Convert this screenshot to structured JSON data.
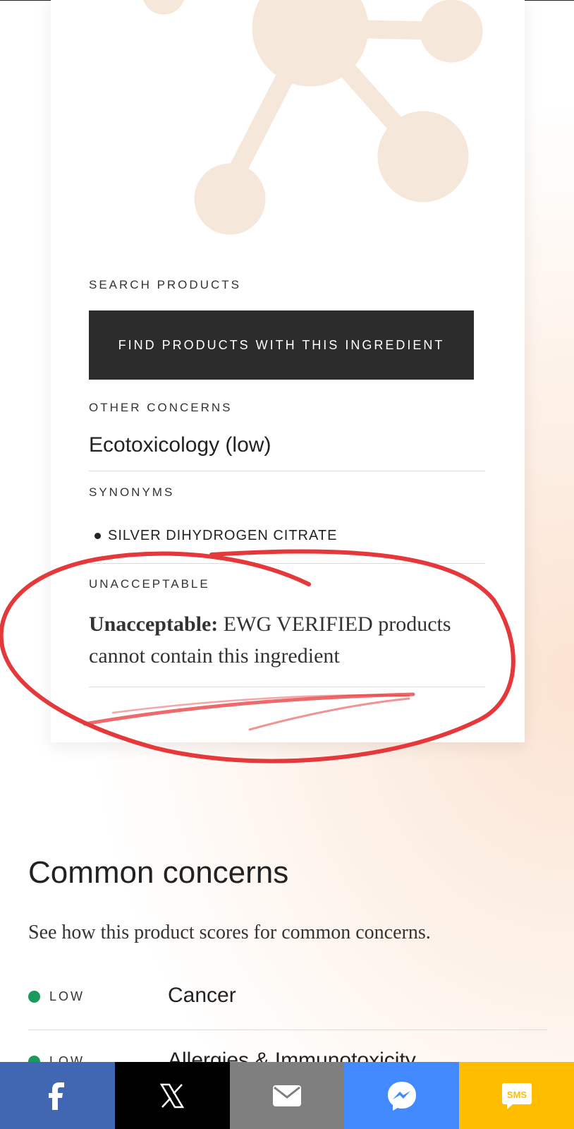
{
  "card": {
    "search_label": "SEARCH PRODUCTS",
    "find_button": "FIND PRODUCTS WITH THIS INGREDIENT",
    "other_concerns_label": "OTHER CONCERNS",
    "other_concerns_value": "Ecotoxicology (low)",
    "synonyms_label": "SYNONYMS",
    "synonyms": [
      "SILVER DIHYDROGEN CITRATE"
    ],
    "unacceptable_label": "UNACCEPTABLE",
    "unacceptable_bold": "Unacceptable:",
    "unacceptable_text": " EWG VERIFIED products cannot contain this ingredient"
  },
  "common_concerns": {
    "title": "Common concerns",
    "subtitle": "See how this product scores for common concerns.",
    "rows": [
      {
        "level": "LOW",
        "name": "Cancer"
      },
      {
        "level": "LOW",
        "name": "Allergies & Immunotoxicity"
      }
    ]
  },
  "share_bar": {
    "items": [
      {
        "name": "facebook",
        "color": "#4267b2"
      },
      {
        "name": "x",
        "color": "#000000"
      },
      {
        "name": "email",
        "color": "#7f7f7f"
      },
      {
        "name": "messenger",
        "color": "#448aff"
      },
      {
        "name": "sms",
        "color": "#ffbd00",
        "label": "SMS"
      }
    ]
  },
  "colors": {
    "molecule": "#f5e7d9",
    "annotation": "#e5383b",
    "low_dot": "#1a9a5a"
  }
}
